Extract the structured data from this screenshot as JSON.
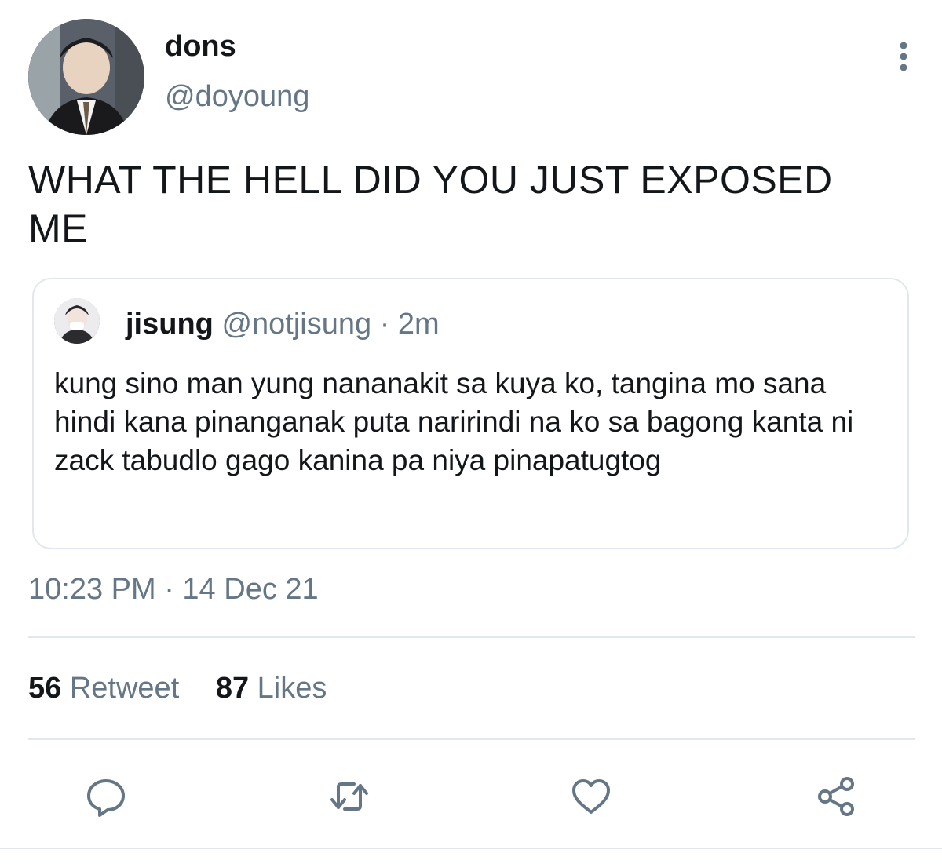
{
  "author": {
    "display_name": "dons",
    "handle": "@doyoung",
    "avatar_icon": "user-avatar"
  },
  "tweet": {
    "text": "WHAT THE HELL DID YOU JUST EXPOSED ME"
  },
  "quoted": {
    "display_name": "jisung",
    "handle": "@notjisung",
    "separator": "·",
    "time": "2m",
    "text": "kung sino man yung nananakit sa kuya ko, tangina mo sana hindi kana pinanganak puta naririndi na ko sa bagong kanta ni zack tabudlo gago kanina pa niya pinapatugtog"
  },
  "timestamp": "10:23 PM · 14 Dec 21",
  "stats": {
    "retweets_count": "56",
    "retweets_label": "Retweet",
    "likes_count": "87",
    "likes_label": "Likes"
  },
  "actions": {
    "reply_icon": "reply-icon",
    "retweet_icon": "retweet-icon",
    "like_icon": "heart-icon",
    "share_icon": "share-icon"
  },
  "colors": {
    "text": "#14171a",
    "secondary": "#657786",
    "border": "#e1e8ed"
  }
}
